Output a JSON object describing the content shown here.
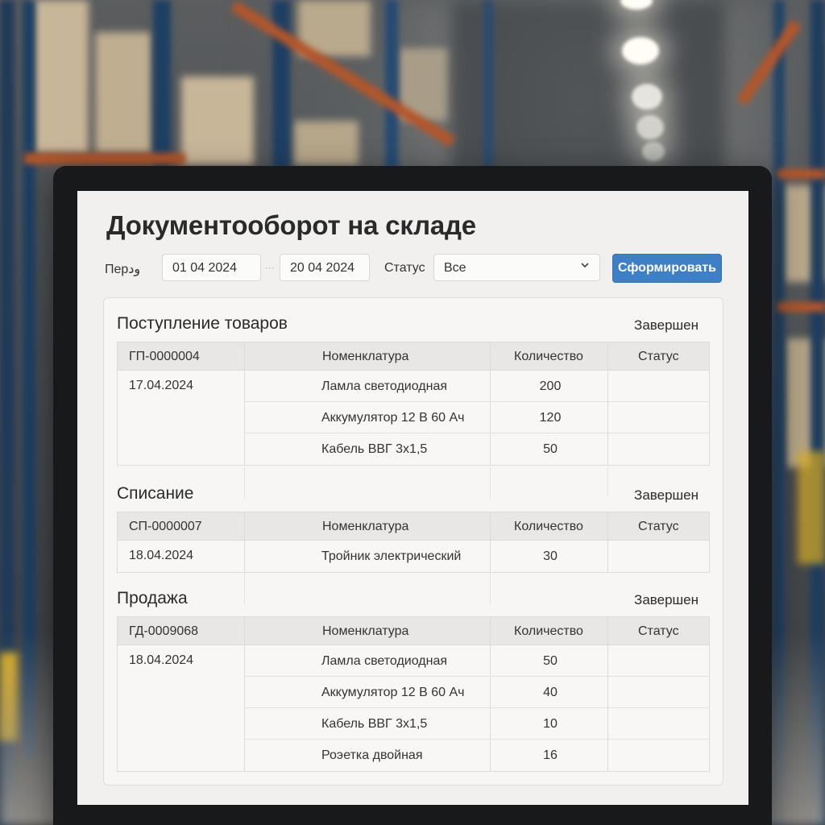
{
  "app": {
    "title": "Документооборот на складе"
  },
  "filters": {
    "period_label": "Перود",
    "date_from": "01 04 2024",
    "date_to": "20 04 2024",
    "status_label": "Статус",
    "status_value": "Все",
    "submit_label": "Сформировать"
  },
  "columns": {
    "name": "Номенклатура",
    "qty": "Количество",
    "status": "Статус"
  },
  "sections": [
    {
      "title": "Поступление товаров",
      "status": "Завершен",
      "doc_number": "ГП-0000004",
      "date": "17.04.2024",
      "rows": [
        {
          "name": "Ламла светодиодная",
          "qty": "200"
        },
        {
          "name": "Аккумулятор 12 В 60 Ач",
          "qty": "120"
        },
        {
          "name": "Кабель ВВГ 3х1,5",
          "qty": "50"
        }
      ]
    },
    {
      "title": "Списание",
      "status": "Завершен",
      "doc_number": "СП-0000007",
      "date": "18.04.2024",
      "rows": [
        {
          "name": "Тройник электрический",
          "qty": "30"
        }
      ]
    },
    {
      "title": "Продажа",
      "status": "Завершен",
      "doc_number": "ГД-0009068",
      "date": "18.04.2024",
      "rows": [
        {
          "name": "Ламла светодиодная",
          "qty": "50"
        },
        {
          "name": "Аккумулятор 12 В 60 Ач",
          "qty": "40"
        },
        {
          "name": "Кабель ВВГ 3х1,5",
          "qty": "10"
        },
        {
          "name": "Роэетка двойная",
          "qty": "16"
        }
      ]
    }
  ],
  "icons": {
    "status_dropdown": "chevron-down-icon"
  },
  "colors": {
    "accent": "#3f7fc6",
    "screen_bg": "#f1f0ee",
    "header_bg": "#e8e7e5"
  }
}
